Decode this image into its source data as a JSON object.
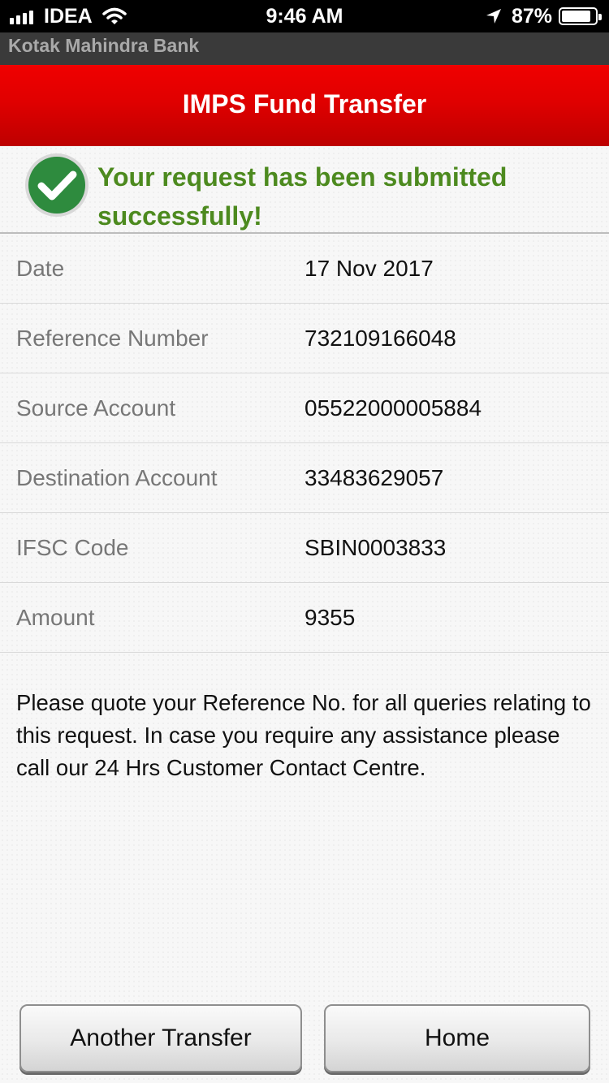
{
  "status_bar": {
    "carrier": "IDEA",
    "time": "9:46 AM",
    "battery_percent": "87%",
    "battery_level": 0.87
  },
  "app": {
    "bank_name": "Kotak Mahindra Bank",
    "title": "IMPS Fund Transfer"
  },
  "success": {
    "message": "Your request has been submitted successfully!",
    "color": "#4d8a1f"
  },
  "details": [
    {
      "label": "Date",
      "value": "17 Nov 2017"
    },
    {
      "label": "Reference Number",
      "value": "732109166048"
    },
    {
      "label": "Source Account",
      "value": "05522000005884"
    },
    {
      "label": "Destination Account",
      "value": "33483629057"
    },
    {
      "label": "IFSC Code",
      "value": "SBIN0003833"
    },
    {
      "label": "Amount",
      "value": "9355"
    }
  ],
  "note": "Please quote your Reference No. for all queries relating to this request. In case you require any assistance please call our 24 Hrs Customer Contact Centre.",
  "buttons": {
    "another_transfer": "Another Transfer",
    "home": "Home"
  },
  "colors": {
    "header_red": "#e00000",
    "success_green": "#4d8a1f",
    "check_circle": "#2e8b3e"
  }
}
